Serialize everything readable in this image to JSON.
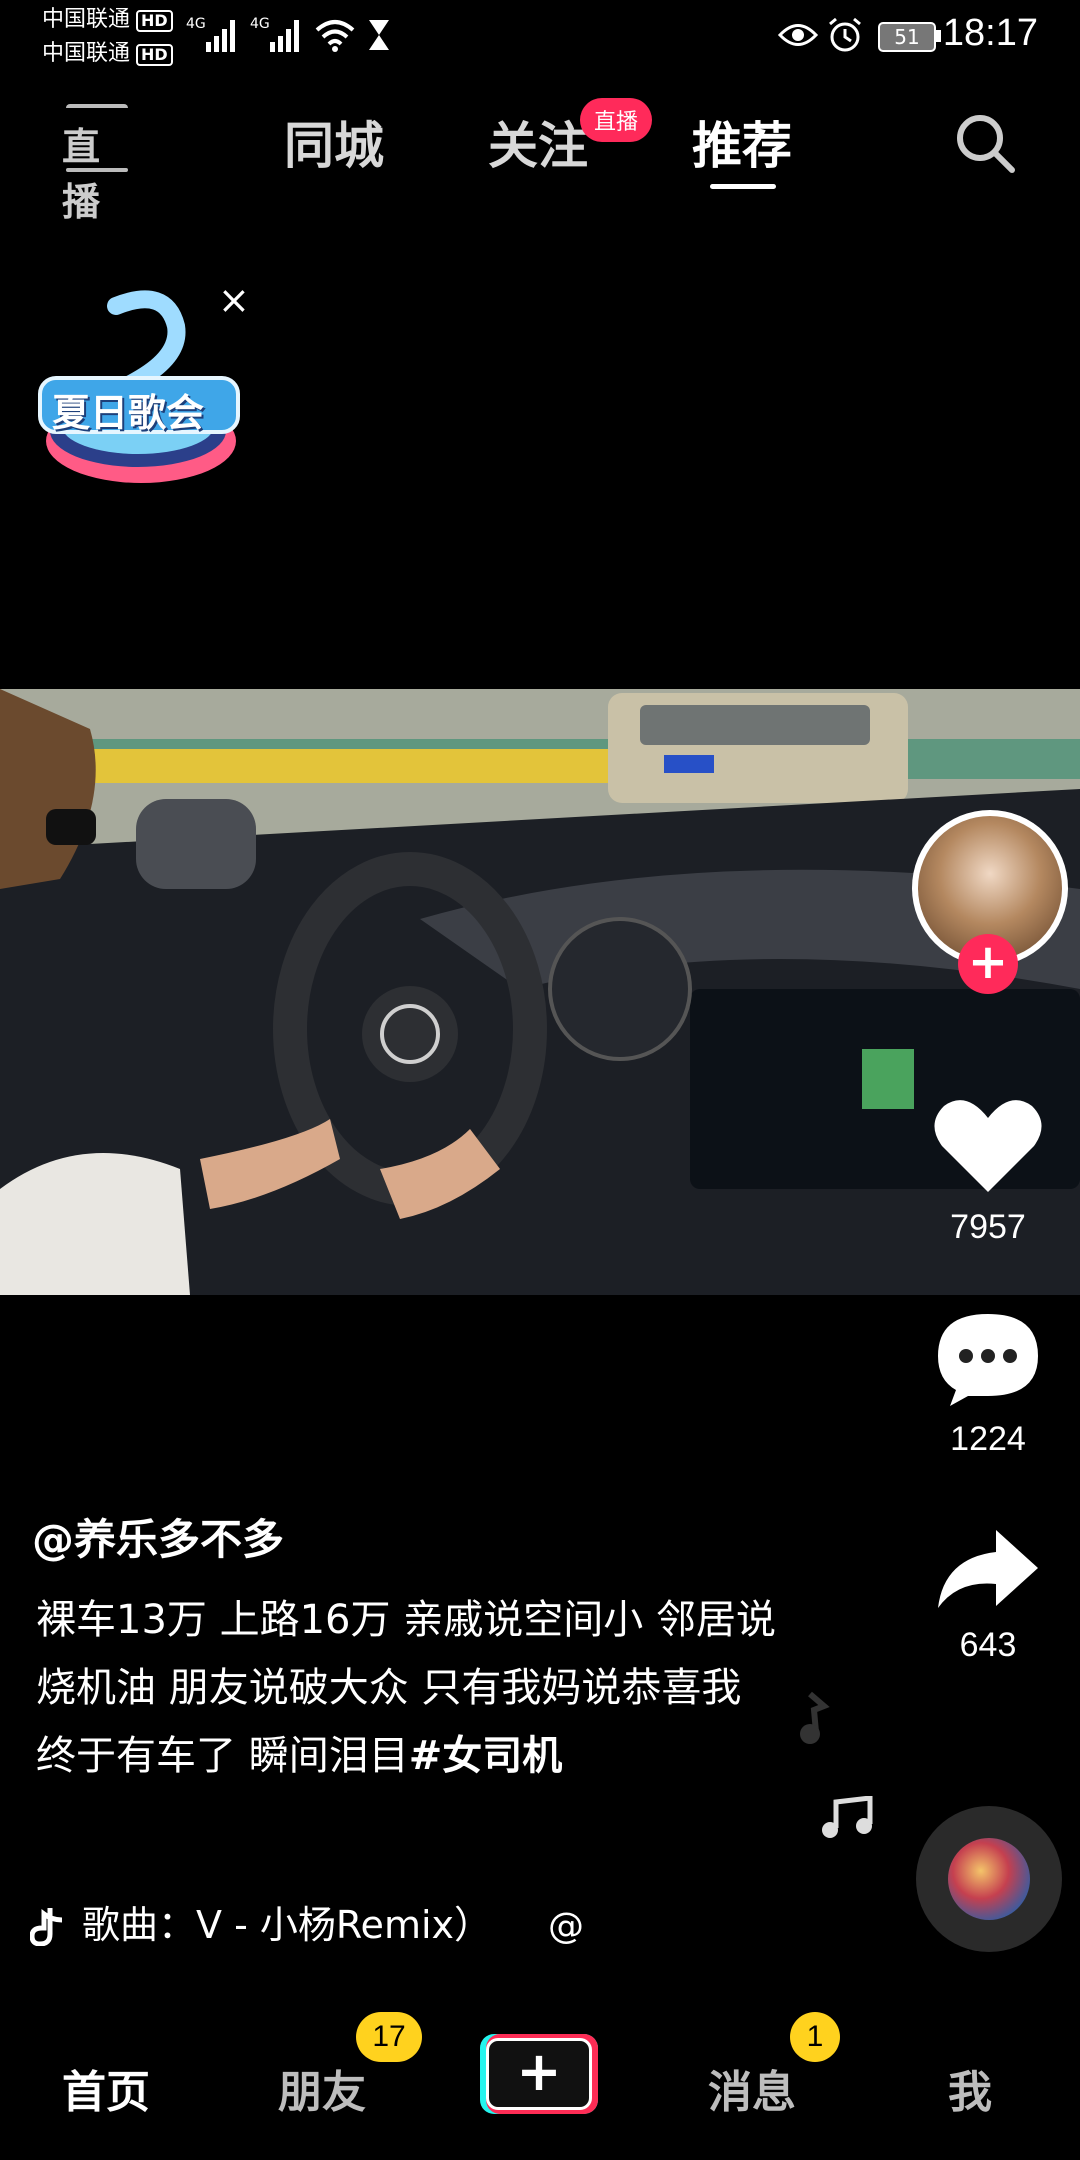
{
  "status_bar": {
    "carrier_1": "中国联通",
    "carrier_2": "中国联通",
    "hd": "HD",
    "network": "4G",
    "battery": "51",
    "time": "18:17"
  },
  "top_nav": {
    "live_icon_label": "直播",
    "tabs": [
      "同城",
      "关注",
      "推荐"
    ],
    "follow_badge": "直播",
    "active_tab": "推荐"
  },
  "promo": {
    "title": "夏日歌会",
    "close": "×"
  },
  "right_rail": {
    "likes": "7957",
    "comments": "1224",
    "shares": "643"
  },
  "caption": {
    "author": "@养乐多不多",
    "text": "裸车13万 上路16万 亲戚说空间小 邻居说烧机油 朋友说破大众 只有我妈说恭喜我终于有车了 瞬间泪目",
    "hashtag": "#女司机",
    "music": "歌曲：V - 小杨Remix）",
    "music_tail": "@"
  },
  "bottom_nav": {
    "home": "首页",
    "friends": "朋友",
    "friends_badge": "17",
    "messages": "消息",
    "messages_badge": "1",
    "me": "我",
    "add": "+"
  },
  "colors": {
    "accent_red": "#ff2a5a",
    "badge_yellow": "#ffd21e",
    "background": "#000000"
  }
}
